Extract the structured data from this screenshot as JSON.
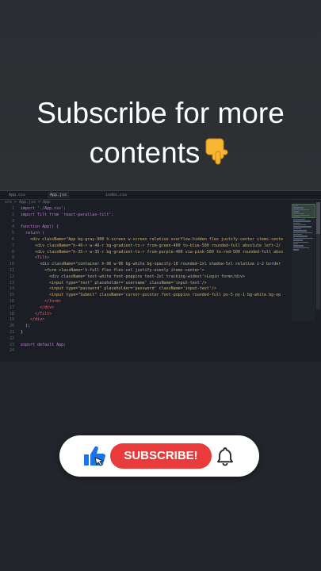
{
  "caption": {
    "line1": "Subscribe for more",
    "line2": "contents"
  },
  "editor": {
    "tabs": [
      "App.jsx",
      "index.css",
      "App.css"
    ],
    "breadcrumb": "src > App.jsx > App",
    "lines": [
      {
        "n": "1",
        "t": "import './App.css';"
      },
      {
        "n": "2",
        "t": "import Tilt from 'react-parallax-tilt';"
      },
      {
        "n": "3",
        "t": ""
      },
      {
        "n": "4",
        "t": "function App() {"
      },
      {
        "n": "5",
        "t": "  return ("
      },
      {
        "n": "6",
        "t": "    <div className=\"App bg-gray-900 h-screen w-screen relative overflow-hidden flex justify-center items-cente"
      },
      {
        "n": "7",
        "t": "      <div className=\"h-40-r w-40-r bg-gradient-to-r from-green-400 to-blue-500 rounded-full absolute left-2/"
      },
      {
        "n": "8",
        "t": "      <div className=\"h-35-r w-35-r bg-gradient-to-r from-purple-400 via-pink-500 to-red-500 rounded-full abso"
      },
      {
        "n": "9",
        "t": "      <Tilt>"
      },
      {
        "n": "10",
        "t": "        <div className=\"container h-96 w-96 bg-white bg-opacity-10 rounded-2xl shadow-5xl relative z-2 border"
      },
      {
        "n": "11",
        "t": "          <form className='h-full flex flex-col justify-evenly items-center'>"
      },
      {
        "n": "12",
        "t": "            <div className='text-white font-poppins text-2xl tracking-widest'>Login form</div>"
      },
      {
        "n": "13",
        "t": "            <input type=\"text\" placeholder='username' className='input-text'/>"
      },
      {
        "n": "14",
        "t": "            <input type=\"password\" placeholder='password' className='input-text'/>"
      },
      {
        "n": "15",
        "t": "            <input type=\"Submit\" className='cursor-pointer font-poppins rounded-full px-5 py-1 bg-white bg-op"
      },
      {
        "n": "16",
        "t": "          </form>"
      },
      {
        "n": "17",
        "t": "        </div>"
      },
      {
        "n": "18",
        "t": "      </Tilt>"
      },
      {
        "n": "19",
        "t": "    </div>"
      },
      {
        "n": "20",
        "t": "  );"
      },
      {
        "n": "21",
        "t": "}"
      },
      {
        "n": "22",
        "t": ""
      },
      {
        "n": "23",
        "t": "export default App;"
      },
      {
        "n": "24",
        "t": ""
      }
    ]
  },
  "subscribe": {
    "label": "SUBSCRIBE!",
    "button_color": "#e93b3b"
  },
  "colors": {
    "background": "#22262c",
    "editor_bg": "#1b1e24",
    "caption_text": "#ffffff"
  }
}
